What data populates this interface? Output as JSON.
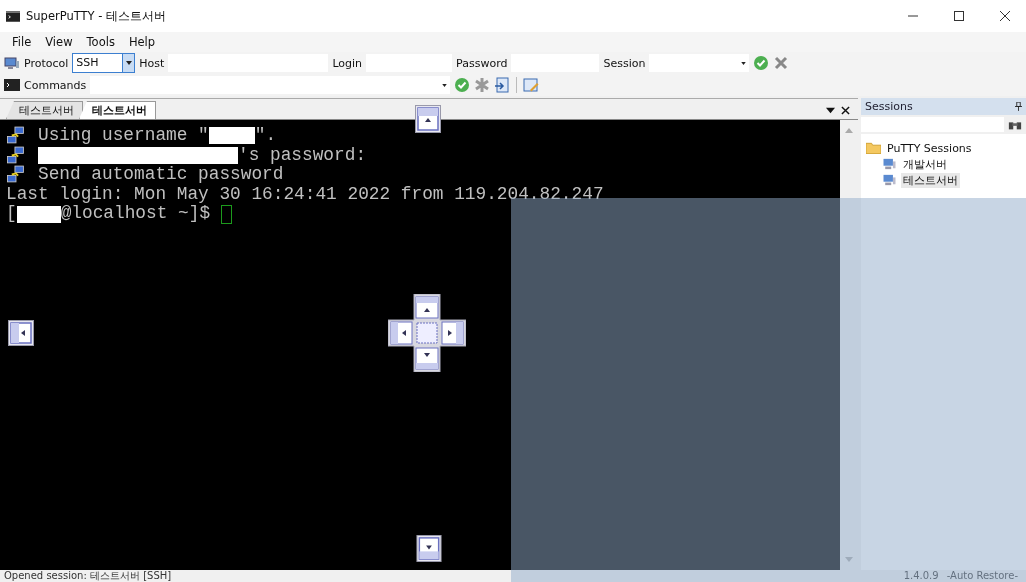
{
  "window": {
    "title": "SuperPuTTY - 테스트서버"
  },
  "menu": [
    "File",
    "View",
    "Tools",
    "Help"
  ],
  "connection_bar": {
    "protocol_label": "Protocol",
    "protocol": "SSH",
    "host_label": "Host",
    "login_label": "Login",
    "password_label": "Password",
    "session_label": "Session"
  },
  "commands_bar": {
    "label": "Commands"
  },
  "tabs": [
    {
      "label": "테스트서버",
      "selected": false
    },
    {
      "label": "테스트서버",
      "selected": true
    }
  ],
  "terminal": {
    "lines": [
      {
        "icon": true,
        "parts": [
          {
            "kind": "text",
            "text": "Using username \""
          },
          {
            "kind": "redacted"
          },
          {
            "kind": "text",
            "text": "\"."
          }
        ]
      },
      {
        "icon": true,
        "parts": [
          {
            "kind": "redacted"
          },
          {
            "kind": "text",
            "text": "'s password:"
          }
        ]
      },
      {
        "icon": true,
        "parts": [
          {
            "kind": "text",
            "text": "Send automatic password"
          }
        ]
      },
      {
        "icon": false,
        "parts": [
          {
            "kind": "text",
            "text": "Last login: Mon May 30 16:24:41 2022 from 119.204.82.247"
          }
        ]
      },
      {
        "icon": false,
        "parts": [
          {
            "kind": "text",
            "text": "["
          },
          {
            "kind": "redacted"
          },
          {
            "kind": "text",
            "text": "@localhost ~]$ "
          },
          {
            "kind": "cursor"
          }
        ]
      }
    ]
  },
  "sessions_panel": {
    "title": "Sessions",
    "tree": [
      {
        "label": "PuTTY Sessions",
        "kind": "folder",
        "selected": false,
        "children": [
          {
            "label": "개발서버",
            "kind": "session",
            "selected": false
          },
          {
            "label": "테스트서버",
            "kind": "session",
            "selected": true
          }
        ]
      }
    ]
  },
  "status_bar": {
    "message": "Opened session: 테스트서버 [SSH]",
    "version": "1.4.0.9",
    "mode": "-Auto Restore-"
  }
}
